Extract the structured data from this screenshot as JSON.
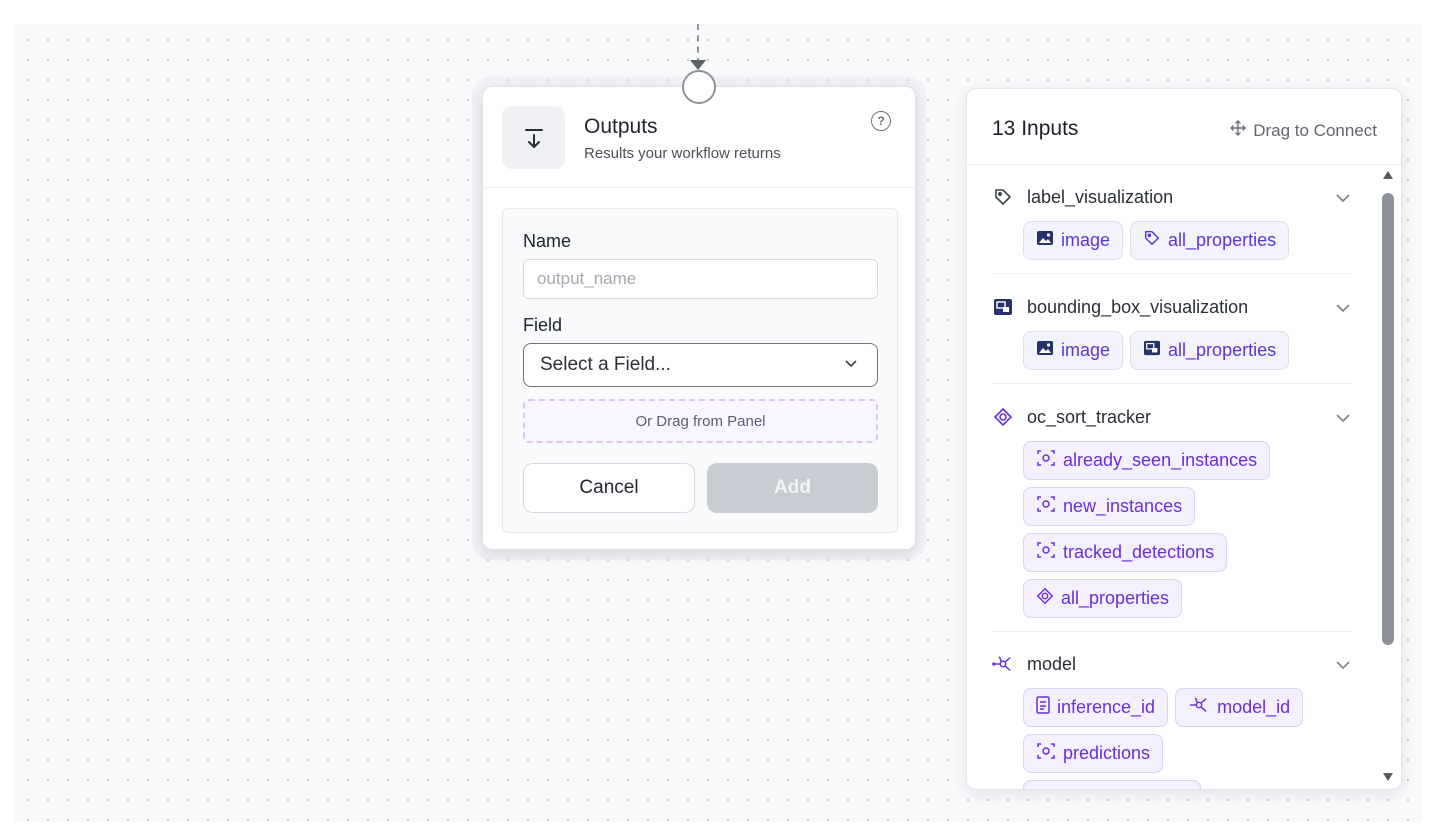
{
  "outputs_card": {
    "title": "Outputs",
    "subtitle": "Results your workflow returns",
    "help_glyph": "?",
    "name_label": "Name",
    "name_placeholder": "output_name",
    "field_label": "Field",
    "field_select_value": "Select a Field...",
    "drag_zone_text": "Or Drag from Panel",
    "cancel_label": "Cancel",
    "add_label": "Add"
  },
  "inputs_panel": {
    "title": "13 Inputs",
    "drag_connect_label": "Drag to Connect",
    "groups": [
      {
        "name": "label_visualization",
        "icon": "tag-icon",
        "chips": [
          {
            "label": "image",
            "icon": "image-icon"
          },
          {
            "label": "all_properties",
            "icon": "tag-icon"
          }
        ]
      },
      {
        "name": "bounding_box_visualization",
        "icon": "bounding-box-icon",
        "chips": [
          {
            "label": "image",
            "icon": "image-icon"
          },
          {
            "label": "all_properties",
            "icon": "bounding-box-icon"
          }
        ]
      },
      {
        "name": "oc_sort_tracker",
        "icon": "target-icon",
        "chips": [
          {
            "label": "already_seen_instances",
            "icon": "detections-icon"
          },
          {
            "label": "new_instances",
            "icon": "detections-icon"
          },
          {
            "label": "tracked_detections",
            "icon": "detections-icon"
          },
          {
            "label": "all_properties",
            "icon": "target-icon"
          }
        ]
      },
      {
        "name": "model",
        "icon": "model-icon",
        "chips": [
          {
            "label": "inference_id",
            "icon": "id-icon"
          },
          {
            "label": "model_id",
            "icon": "model-icon"
          },
          {
            "label": "predictions",
            "icon": "detections-icon"
          }
        ]
      }
    ]
  },
  "colors": {
    "accent_purple": "#6a2fd6",
    "chip_bg": "#f4f0fd",
    "add_disabled": "#c9ccd2"
  }
}
